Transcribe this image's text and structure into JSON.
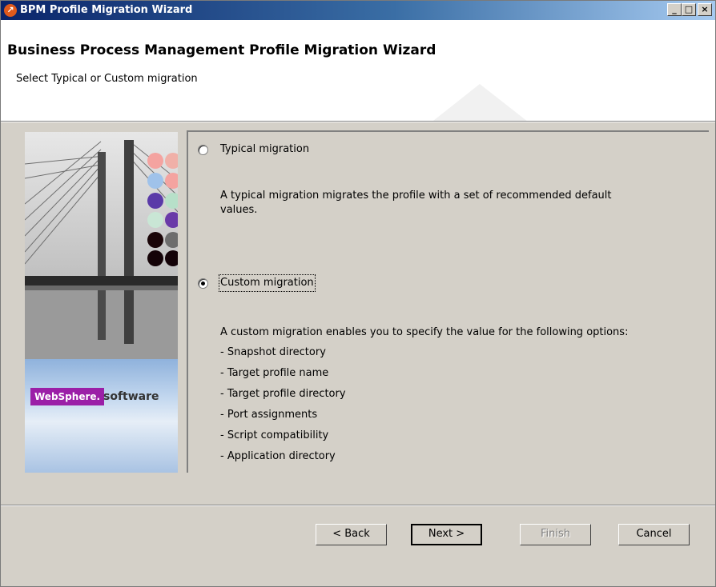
{
  "window": {
    "title": "BPM Profile Migration Wizard",
    "controls": {
      "minimize": "_",
      "maximize": "□",
      "close": "×"
    }
  },
  "header": {
    "title": "Business Process Management Profile Migration Wizard",
    "subtitle": "Select Typical or Custom migration"
  },
  "left_image": {
    "brand": "WebSphere.",
    "tagline": "software"
  },
  "options": [
    {
      "label": "Typical migration",
      "selected": false,
      "description_lines": [
        "A typical migration migrates the profile with a set of recommended default",
        "values."
      ]
    },
    {
      "label": "Custom migration",
      "selected": true,
      "description": "A custom migration enables you to specify the value for the following options:",
      "items": [
        "- Snapshot directory",
        "- Target profile name",
        "- Target profile directory",
        "- Port assignments",
        "- Script compatibility",
        "- Application directory"
      ]
    }
  ],
  "buttons": {
    "back": "< Back",
    "next": "Next >",
    "finish": "Finish",
    "cancel": "Cancel"
  }
}
